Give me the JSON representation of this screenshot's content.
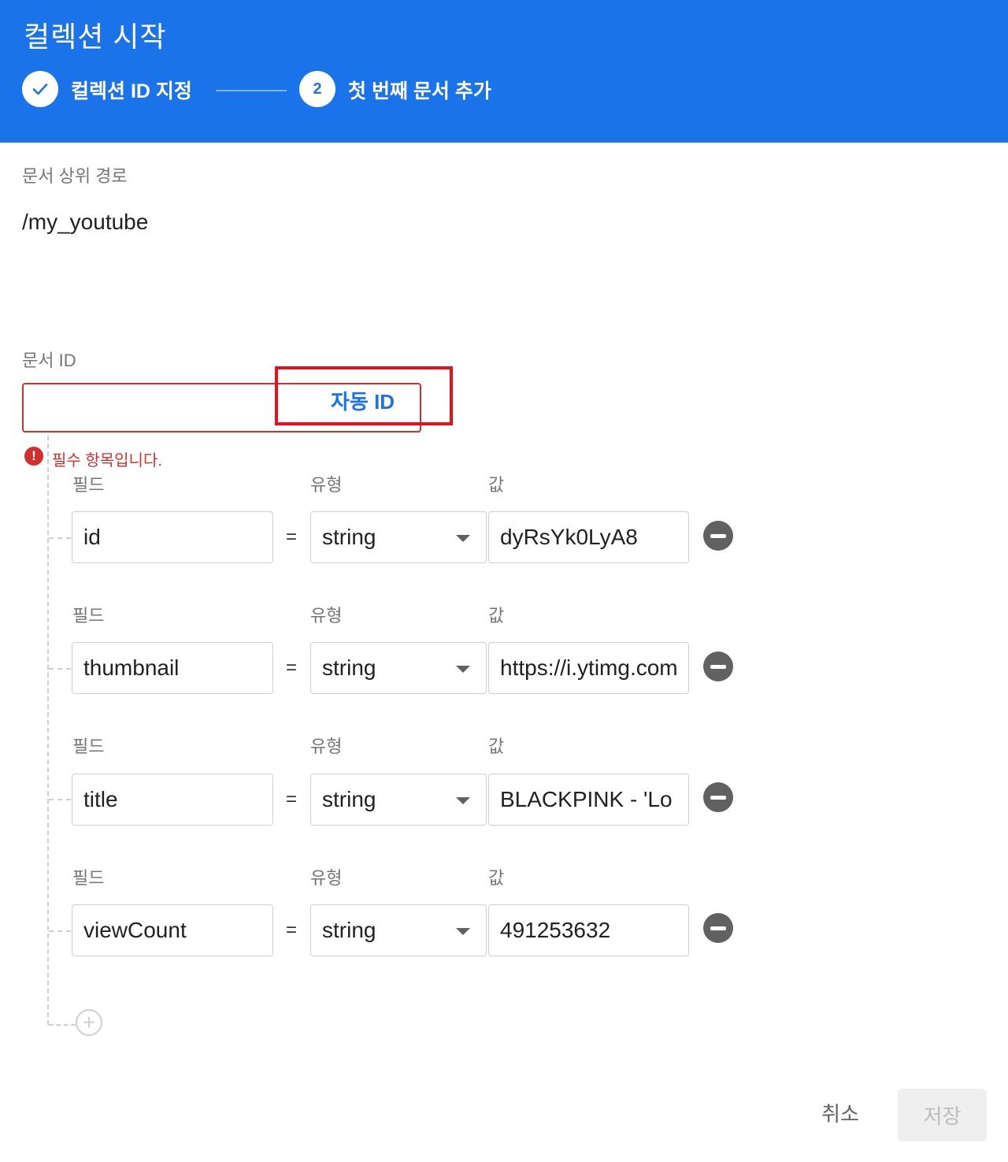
{
  "header": {
    "title": "컬렉션 시작",
    "steps": [
      {
        "label": "컬렉션 ID 지정",
        "state": "done",
        "icon": "check-icon"
      },
      {
        "number": "2",
        "label": "첫 번째 문서 추가",
        "state": "active"
      }
    ]
  },
  "parent_path": {
    "label": "문서 상위 경로",
    "value": "/my_youtube"
  },
  "document_id": {
    "label": "문서 ID",
    "value": "",
    "auto_id_label": "자동 ID",
    "error_text": "필수 항목입니다.",
    "error_icon": "!"
  },
  "field_labels": {
    "field": "필드",
    "type": "유형",
    "value": "값"
  },
  "equals": "=",
  "fields": [
    {
      "name": "id",
      "type": "string",
      "value": "dyRsYk0LyA8"
    },
    {
      "name": "thumbnail",
      "type": "string",
      "value": "https://i.ytimg.com"
    },
    {
      "name": "title",
      "type": "string",
      "value": "BLACKPINK - 'Lo"
    },
    {
      "name": "viewCount",
      "type": "string",
      "value": "491253632"
    }
  ],
  "add_field_icon": "+",
  "actions": {
    "cancel": "취소",
    "save": "저장"
  },
  "colors": {
    "header": "#1a73e8",
    "error": "#d32f2f",
    "highlight": "#e8101a"
  }
}
